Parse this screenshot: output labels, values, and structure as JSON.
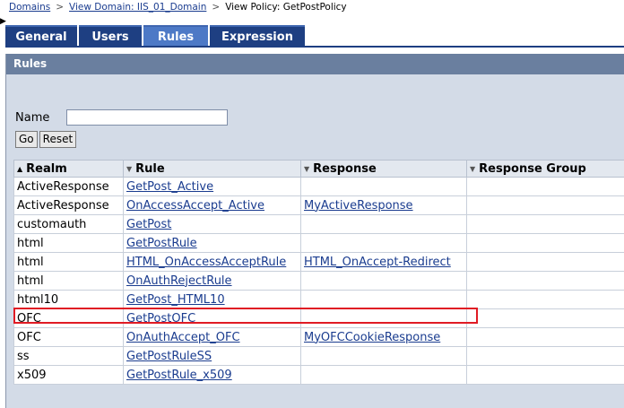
{
  "breadcrumb": {
    "domains": "Domains",
    "view_domain": "View Domain: IIS_01_Domain",
    "current": "View Policy: GetPostPolicy",
    "separator": ">"
  },
  "tabs": [
    {
      "label": "General",
      "active": false
    },
    {
      "label": "Users",
      "active": false
    },
    {
      "label": "Rules",
      "active": true
    },
    {
      "label": "Expression",
      "active": false
    }
  ],
  "panel": {
    "title": "Rules",
    "name_label": "Name",
    "name_value": "",
    "go_label": "Go",
    "reset_label": "Reset"
  },
  "table": {
    "columns": [
      "Realm",
      "Rule",
      "Response",
      "Response Group"
    ],
    "rows": [
      {
        "realm": "ActiveResponse",
        "rule": "GetPost_Active",
        "response": ""
      },
      {
        "realm": "ActiveResponse",
        "rule": "OnAccessAccept_Active",
        "response": "MyActiveResponse"
      },
      {
        "realm": "customauth",
        "rule": "GetPost",
        "response": ""
      },
      {
        "realm": "html",
        "rule": "GetPostRule",
        "response": ""
      },
      {
        "realm": "html",
        "rule": "HTML_OnAccessAcceptRule",
        "response": "HTML_OnAccept-Redirect"
      },
      {
        "realm": "html",
        "rule": "OnAuthRejectRule",
        "response": ""
      },
      {
        "realm": "html10",
        "rule": "GetPost_HTML10",
        "response": ""
      },
      {
        "realm": "OFC",
        "rule": "GetPostOFC",
        "response": ""
      },
      {
        "realm": "OFC",
        "rule": "OnAuthAccept_OFC",
        "response": "MyOFCCookieResponse"
      },
      {
        "realm": "ss",
        "rule": "GetPostRuleSS",
        "response": ""
      },
      {
        "realm": "x509",
        "rule": "GetPostRule_x509",
        "response": ""
      }
    ]
  },
  "colors": {
    "tab": "#1e3f82",
    "tab_active": "#4d79c6",
    "panel_bg": "#d3dbe7",
    "panel_header": "#6a7f9f",
    "highlight": "#e01b24"
  }
}
